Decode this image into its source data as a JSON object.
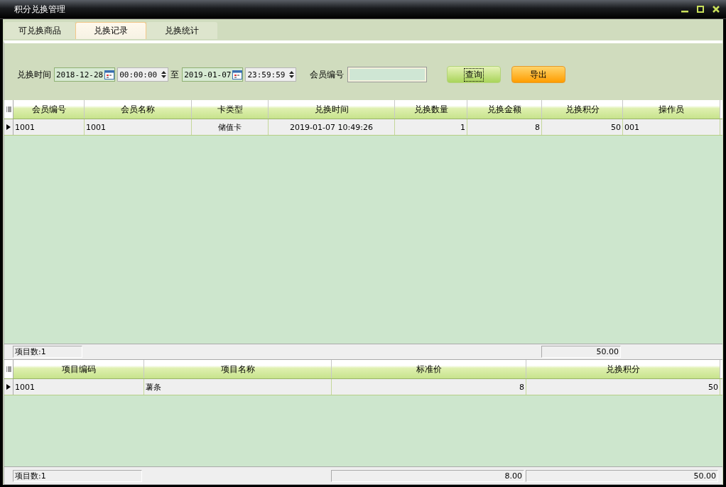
{
  "window": {
    "title": "积分兑换管理"
  },
  "tabs": [
    {
      "label": "可兑换商品",
      "selected": false
    },
    {
      "label": "兑换记录",
      "selected": true
    },
    {
      "label": "兑换统计",
      "selected": false
    }
  ],
  "filter": {
    "time_label": "兑换时间",
    "date_from": "2018-12-28",
    "time_from": "00:00:00",
    "separator": "至",
    "date_to": "2019-01-07",
    "time_to": "23:59:59",
    "member_label": "会员编号",
    "buttons": [
      {
        "label": "查询",
        "kind": "query",
        "focused": true
      },
      {
        "label": "导出",
        "kind": "export",
        "focused": false
      }
    ]
  },
  "tables": [
    {
      "columns": [
        {
          "label": "会员编号",
          "kind": "text",
          "summed": false
        },
        {
          "label": "会员名称",
          "kind": "text",
          "summed": false
        },
        {
          "label": "卡类型",
          "kind": "centered",
          "summed": false
        },
        {
          "label": "兑换时间",
          "kind": "centered",
          "summed": false
        },
        {
          "label": "兑换数量",
          "kind": "number",
          "summed": false
        },
        {
          "label": "兑换金额",
          "kind": "number",
          "summed": false
        },
        {
          "label": "兑换积分",
          "kind": "number",
          "summed": true
        },
        {
          "label": "操作员",
          "kind": "text",
          "summed": false
        }
      ],
      "rows": [
        {
          "selected": true,
          "cells": [
            "1001",
            "1001",
            "储值卡",
            "2019-01-07 10:49:26",
            "1",
            "8",
            "50",
            "001"
          ]
        }
      ],
      "footer": {
        "count": "项目数:1",
        "sums": [
          "50.00"
        ]
      }
    },
    {
      "columns": [
        {
          "label": "项目编码",
          "kind": "text",
          "summed": false
        },
        {
          "label": "项目名称",
          "kind": "text",
          "summed": false
        },
        {
          "label": "标准价",
          "kind": "number",
          "summed": true
        },
        {
          "label": "兑换积分",
          "kind": "number",
          "summed": true
        }
      ],
      "rows": [
        {
          "selected": true,
          "cells": [
            "1001",
            "薯条",
            "8",
            "50"
          ]
        }
      ],
      "footer": {
        "count": "项目数:1",
        "sums": [
          "8.00",
          "50.00"
        ]
      }
    }
  ]
}
